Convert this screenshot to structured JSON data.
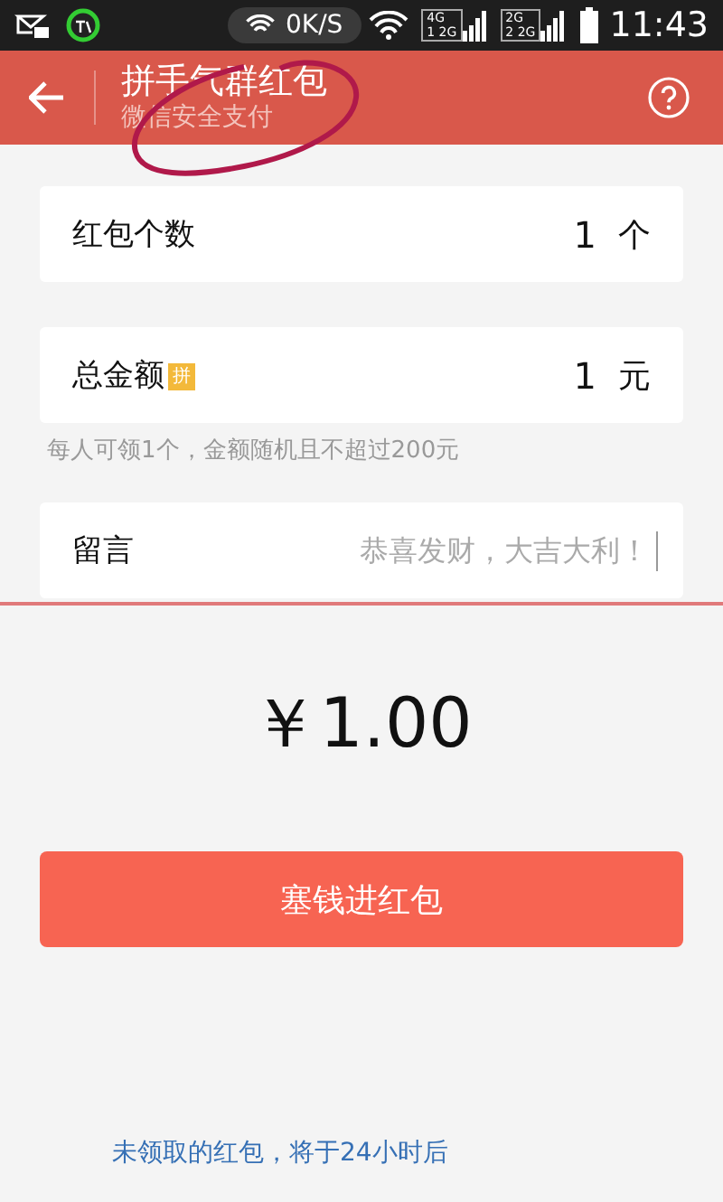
{
  "status_bar": {
    "speed": "0K/S",
    "time": "11:43",
    "signals": [
      {
        "sim": "1",
        "network": "2G",
        "top": "4G"
      },
      {
        "sim": "2",
        "network": "2G",
        "top": "2G"
      }
    ]
  },
  "header": {
    "title": "拼手气群红包",
    "subtitle": "微信安全支付"
  },
  "fields": [
    {
      "kind": "count",
      "label": "红包个数",
      "value": "1",
      "unit": "个"
    },
    {
      "kind": "amount",
      "label": "总金额",
      "tag": "拼",
      "value": "1",
      "unit": "元",
      "hint": "每人可领1个，金额随机且不超过200元"
    },
    {
      "kind": "message",
      "label": "留言",
      "placeholder": "恭喜发财，大吉大利！"
    }
  ],
  "total": "￥1.00",
  "submit": "塞钱进红包",
  "footer_note": "未领取的红包，将于24小时后"
}
